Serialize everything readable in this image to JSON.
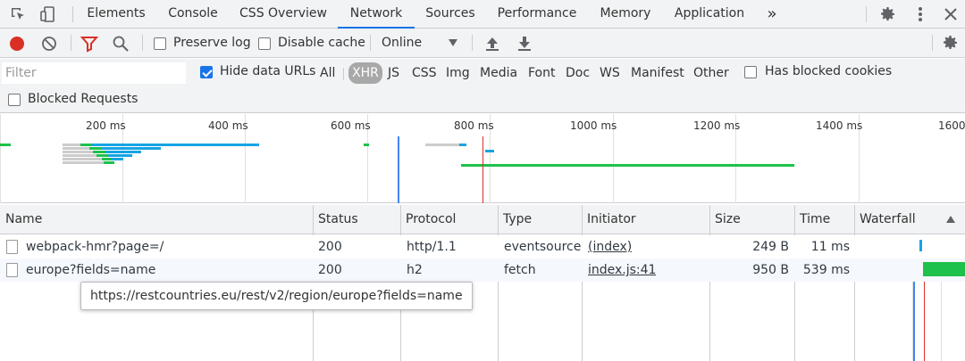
{
  "tabs": [
    {
      "label": "Elements"
    },
    {
      "label": "Console"
    },
    {
      "label": "CSS Overview"
    },
    {
      "label": "Network"
    },
    {
      "label": "Sources"
    },
    {
      "label": "Performance"
    },
    {
      "label": "Memory"
    },
    {
      "label": "Application"
    }
  ],
  "more_tabs": "»",
  "toolbar": {
    "preserve_log": "Preserve log",
    "disable_cache": "Disable cache",
    "throttle": "Online"
  },
  "filter": {
    "placeholder": "Filter",
    "hide_data_urls": "Hide data URLs",
    "types": [
      "All",
      "XHR",
      "JS",
      "CSS",
      "Img",
      "Media",
      "Font",
      "Doc",
      "WS",
      "Manifest",
      "Other"
    ],
    "active_type": "XHR",
    "has_blocked_cookies": "Has blocked cookies",
    "blocked_requests": "Blocked Requests"
  },
  "overview": {
    "ticks": [
      "200 ms",
      "400 ms",
      "600 ms",
      "800 ms",
      "1000 ms",
      "1200 ms",
      "1400 ms",
      "1600"
    ]
  },
  "table": {
    "columns": [
      "Name",
      "Status",
      "Protocol",
      "Type",
      "Initiator",
      "Size",
      "Time",
      "Waterfall"
    ],
    "rows": [
      {
        "name": "webpack-hmr?page=/",
        "status": "200",
        "protocol": "http/1.1",
        "type": "eventsource",
        "initiator": "(index)",
        "size": "249 B",
        "time": "11 ms"
      },
      {
        "name": "europe?fields=name",
        "status": "200",
        "protocol": "h2",
        "type": "fetch",
        "initiator": "index.js:41",
        "size": "950 B",
        "time": "539 ms"
      }
    ]
  },
  "tooltip": "https://restcountries.eu/rest/v2/region/europe?fields=name",
  "colors": {
    "accent": "#1a73e8",
    "record": "#d93025",
    "waterfall_green": "#1ec14a",
    "waterfall_blue": "#16a4e3"
  }
}
